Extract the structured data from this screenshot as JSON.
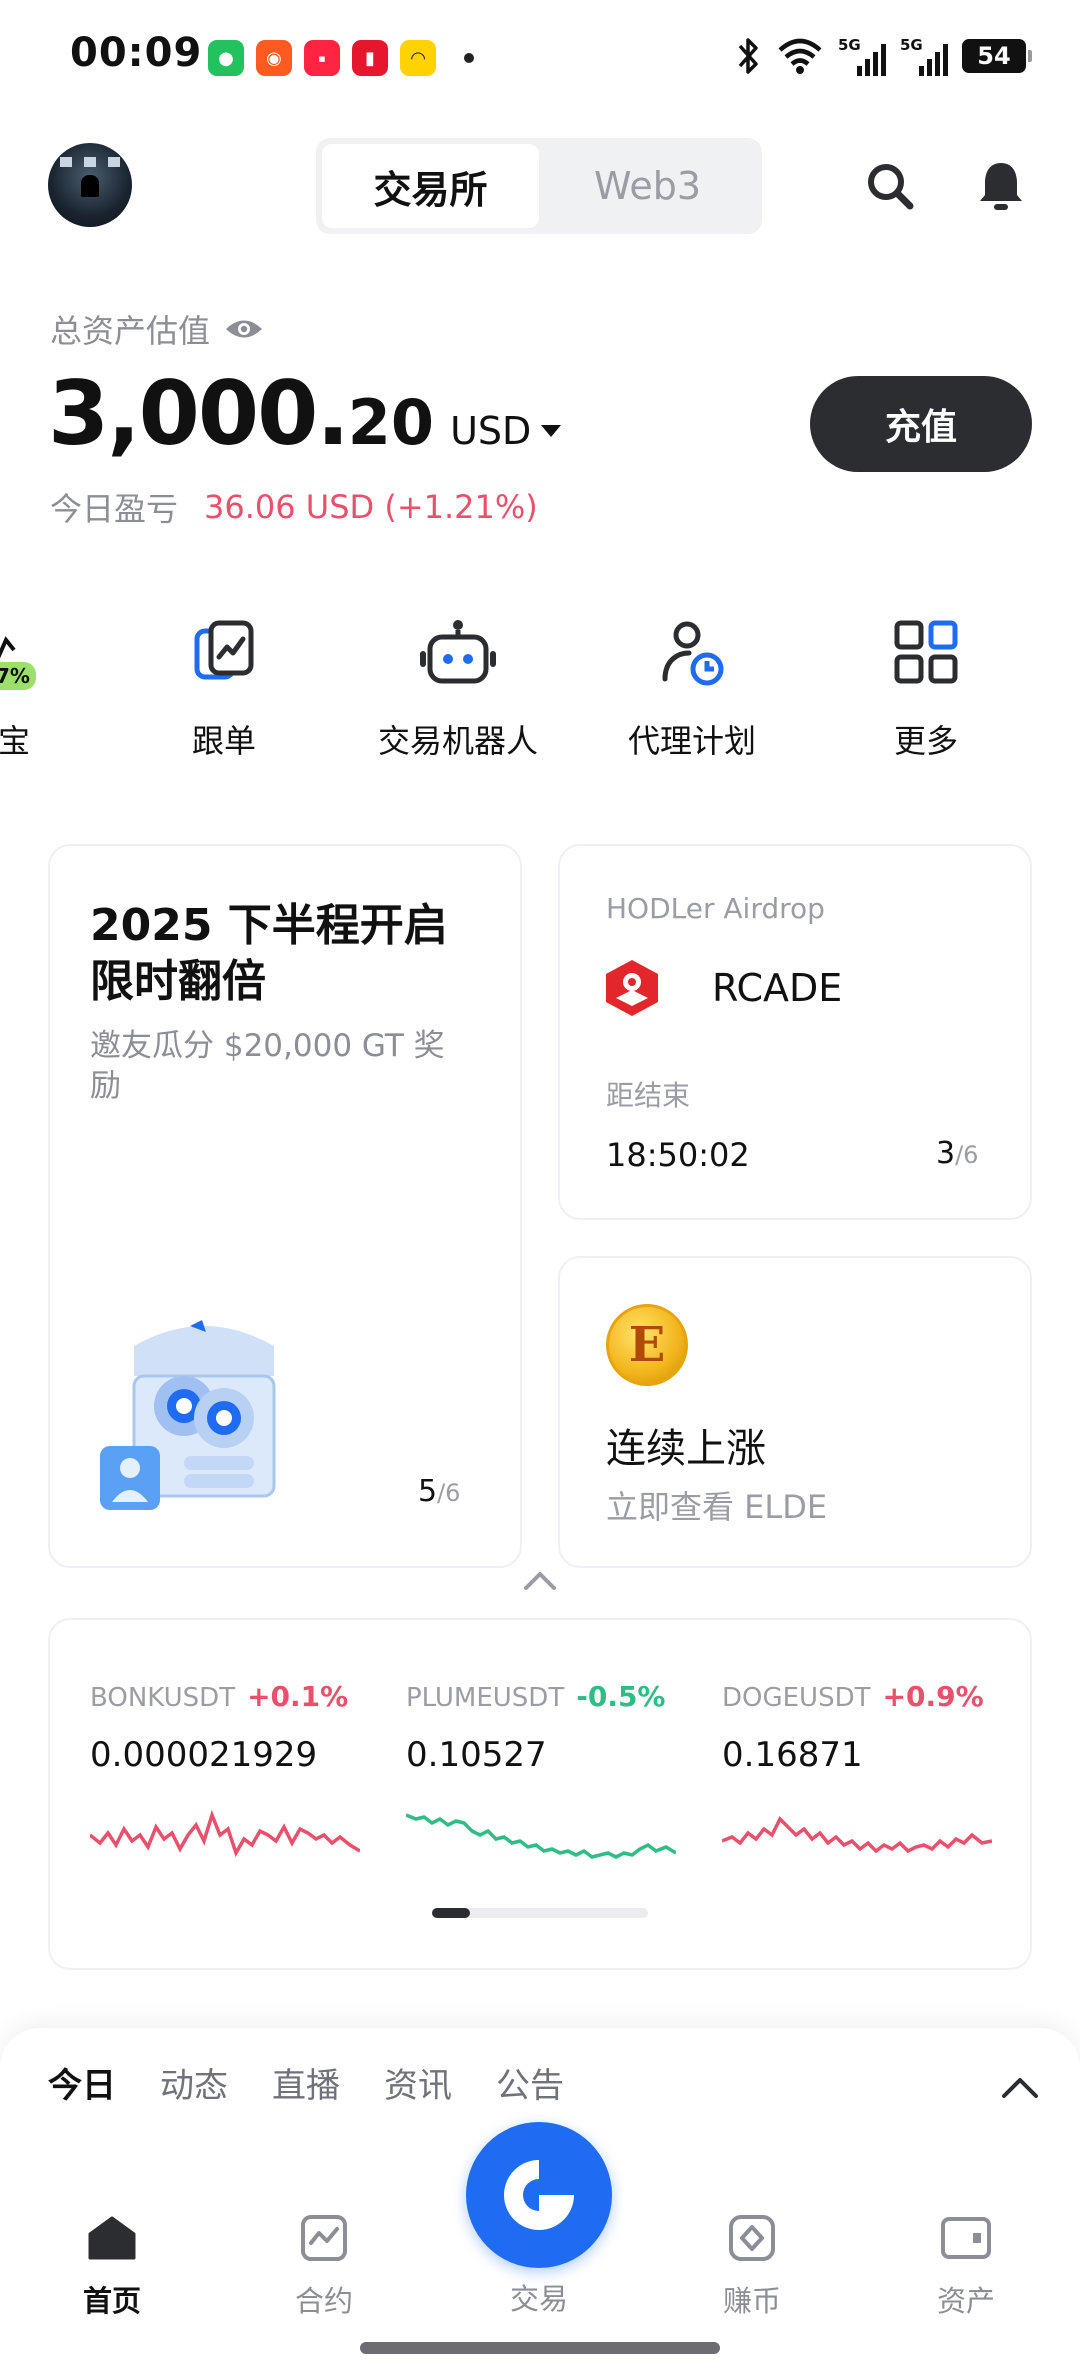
{
  "status_bar": {
    "time": "00:09",
    "battery": "54",
    "network_label": "5G"
  },
  "header": {
    "tabs": [
      {
        "label": "交易所",
        "active": true
      },
      {
        "label": "Web3",
        "active": false
      }
    ],
    "icons": [
      "search-icon",
      "bell-icon"
    ]
  },
  "assets": {
    "label": "总资产估值",
    "value_int": "3,000.",
    "value_dec": "20",
    "currency": "USD",
    "deposit_label": "充值",
    "pnl_label": "今日盈亏",
    "pnl_value": "36.06 USD",
    "pnl_percent": "(+1.21%)",
    "pnl_color": "#e8506b"
  },
  "quick_actions": {
    "partial": {
      "label": "币宝",
      "badge": "7%"
    },
    "items": [
      {
        "label": "跟单",
        "icon": "copy-trade-icon"
      },
      {
        "label": "交易机器人",
        "icon": "robot-icon"
      },
      {
        "label": "代理计划",
        "icon": "agent-icon"
      },
      {
        "label": "更多",
        "icon": "more-grid-icon"
      }
    ],
    "accent": "#1f6cf3"
  },
  "promo_card": {
    "title": "2025 下半程开启限时翻倍",
    "subtitle": "邀友瓜分 $20,000 GT 奖励",
    "page_current": "5",
    "page_total": "/6"
  },
  "airdrop_card": {
    "label": "HODLer Airdrop",
    "token": "RCADE",
    "ends_label": "距结束",
    "countdown": "18:50:02",
    "page_current": "3",
    "page_total": "/6"
  },
  "rise_card": {
    "coin_letter": "E",
    "title": "连续上涨",
    "subtitle": "立即查看 ELDE"
  },
  "tickers": [
    {
      "symbol": "BONKUSDT",
      "change": "+0.1%",
      "price": "0.000021929",
      "trend": "up",
      "color": "#e8506b"
    },
    {
      "symbol": "PLUMEUSDT",
      "change": "-0.5%",
      "price": "0.10527",
      "trend": "down",
      "color": "#2ebd85"
    },
    {
      "symbol": "DOGEUSDT",
      "change": "+0.9%",
      "price": "0.16871",
      "trend": "up",
      "color": "#e8506b"
    }
  ],
  "feed_tabs": [
    {
      "label": "今日",
      "active": true
    },
    {
      "label": "动态",
      "active": false
    },
    {
      "label": "直播",
      "active": false
    },
    {
      "label": "资讯",
      "active": false
    },
    {
      "label": "公告",
      "active": false
    }
  ],
  "bottom_nav": [
    {
      "label": "首页",
      "icon": "home-icon",
      "active": true
    },
    {
      "label": "合约",
      "icon": "futures-icon",
      "active": false
    },
    {
      "label": "交易",
      "icon": "trade-icon",
      "active": false
    },
    {
      "label": "赚币",
      "icon": "earn-icon",
      "active": false
    },
    {
      "label": "资产",
      "icon": "wallet-icon",
      "active": false
    }
  ]
}
